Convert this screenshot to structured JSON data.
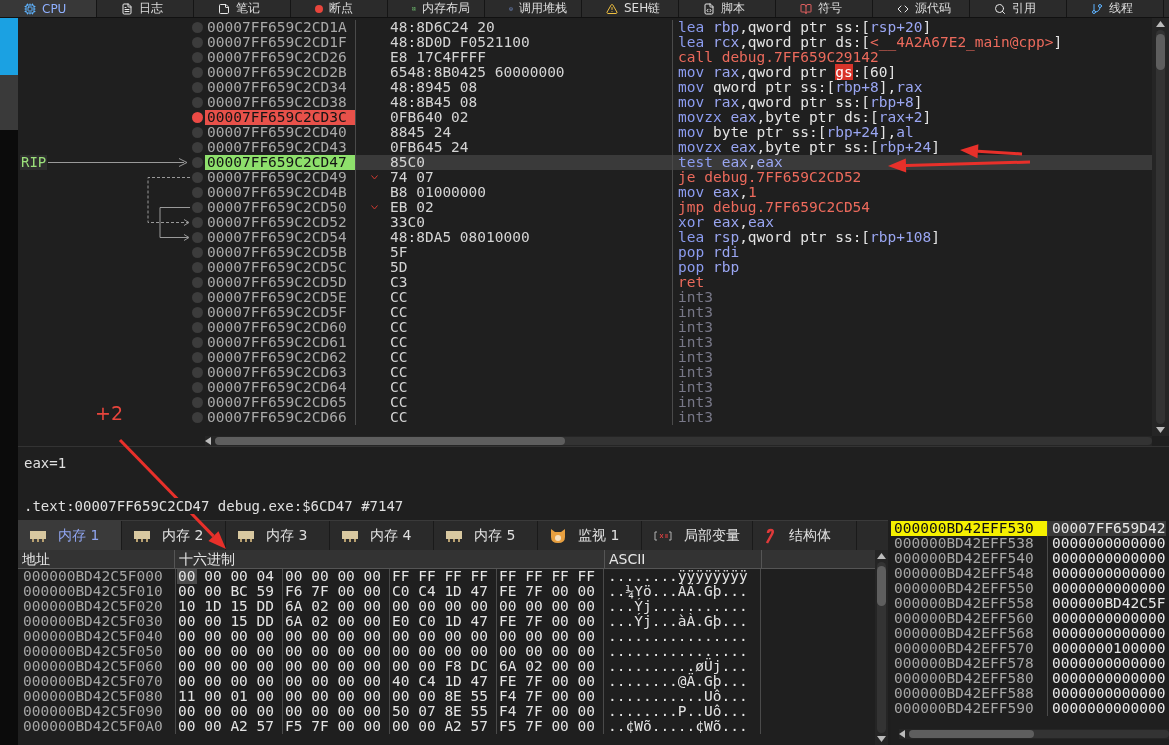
{
  "top_tabs": [
    {
      "label": "CPU",
      "kind": "cpu",
      "selected": true
    },
    {
      "label": "日志",
      "kind": "log",
      "selected": false
    },
    {
      "label": "笔记",
      "kind": "notes",
      "selected": false
    },
    {
      "label": "断点",
      "kind": "breakpoint",
      "selected": false
    },
    {
      "label": "内存布局",
      "kind": "memmap",
      "selected": false
    },
    {
      "label": "调用堆栈",
      "kind": "callstack",
      "selected": false
    },
    {
      "label": "SEH链",
      "kind": "seh",
      "selected": false
    },
    {
      "label": "脚本",
      "kind": "script",
      "selected": false
    },
    {
      "label": "符号",
      "kind": "symbol",
      "selected": false
    },
    {
      "label": "源代码",
      "kind": "source",
      "selected": false
    },
    {
      "label": "引用",
      "kind": "refs",
      "selected": false
    },
    {
      "label": "线程",
      "kind": "threads",
      "selected": false
    }
  ],
  "disasm": {
    "rip_label": "RIP",
    "rows": [
      {
        "address": "00007FF659C2CD1A",
        "bytes": "48:8D6C24 20",
        "mnemonic": "lea",
        "kind": "op",
        "operands": [
          {
            "text": "rbp",
            "kind": "reg"
          },
          {
            "text": ",qword ptr ss:[",
            "kind": "plain"
          },
          {
            "text": "rsp+20",
            "kind": "reg"
          },
          {
            "text": "]",
            "kind": "plain"
          }
        ],
        "breakpoint": false,
        "current": false,
        "jump": false
      },
      {
        "address": "00007FF659C2CD1F",
        "bytes": "48:8D0D F0521100",
        "mnemonic": "lea",
        "kind": "op",
        "operands": [
          {
            "text": "rcx",
            "kind": "reg"
          },
          {
            "text": ",qword ptr ds:[",
            "kind": "plain"
          },
          {
            "text": "<__4A2A67E2_main@cpp>",
            "kind": "addr"
          },
          {
            "text": "]",
            "kind": "plain"
          }
        ],
        "breakpoint": false,
        "current": false,
        "jump": false
      },
      {
        "address": "00007FF659C2CD26",
        "bytes": "E8 17C4FFFF",
        "mnemonic": "call",
        "kind": "branch",
        "operands": [
          {
            "text": "debug.7FF659C29142",
            "kind": "addr"
          }
        ],
        "breakpoint": false,
        "current": false,
        "jump": false
      },
      {
        "address": "00007FF659C2CD2B",
        "bytes": "6548:8B0425 60000000",
        "mnemonic": "mov",
        "kind": "op",
        "operands": [
          {
            "text": "rax",
            "kind": "reg"
          },
          {
            "text": ",qword ptr ",
            "kind": "plain"
          },
          {
            "text": "gs",
            "kind": "mark"
          },
          {
            "text": ":[60]",
            "kind": "plain"
          }
        ],
        "breakpoint": false,
        "current": false,
        "jump": false
      },
      {
        "address": "00007FF659C2CD34",
        "bytes": "48:8945 08",
        "mnemonic": "mov",
        "kind": "op",
        "operands": [
          {
            "text": "qword ptr ss:[",
            "kind": "plain"
          },
          {
            "text": "rbp+8",
            "kind": "reg"
          },
          {
            "text": "],",
            "kind": "plain"
          },
          {
            "text": "rax",
            "kind": "reg"
          }
        ],
        "breakpoint": false,
        "current": false,
        "jump": false
      },
      {
        "address": "00007FF659C2CD38",
        "bytes": "48:8B45 08",
        "mnemonic": "mov",
        "kind": "op",
        "operands": [
          {
            "text": "rax",
            "kind": "reg"
          },
          {
            "text": ",qword ptr ss:[",
            "kind": "plain"
          },
          {
            "text": "rbp+8",
            "kind": "reg"
          },
          {
            "text": "]",
            "kind": "plain"
          }
        ],
        "breakpoint": false,
        "current": false,
        "jump": false
      },
      {
        "address": "00007FF659C2CD3C",
        "bytes": "0FB640 02",
        "mnemonic": "movzx",
        "kind": "op",
        "operands": [
          {
            "text": "eax",
            "kind": "reg"
          },
          {
            "text": ",byte ptr ds:[",
            "kind": "plain"
          },
          {
            "text": "rax+2",
            "kind": "reg"
          },
          {
            "text": "]",
            "kind": "plain"
          }
        ],
        "breakpoint": true,
        "current": false,
        "jump": false
      },
      {
        "address": "00007FF659C2CD40",
        "bytes": "8845 24",
        "mnemonic": "mov",
        "kind": "op",
        "operands": [
          {
            "text": "byte ptr ss:[",
            "kind": "plain"
          },
          {
            "text": "rbp+24",
            "kind": "reg"
          },
          {
            "text": "],",
            "kind": "plain"
          },
          {
            "text": "al",
            "kind": "reg"
          }
        ],
        "breakpoint": false,
        "current": false,
        "jump": false
      },
      {
        "address": "00007FF659C2CD43",
        "bytes": "0FB645 24",
        "mnemonic": "movzx",
        "kind": "op",
        "operands": [
          {
            "text": "eax",
            "kind": "reg"
          },
          {
            "text": ",byte ptr ss:[",
            "kind": "plain"
          },
          {
            "text": "rbp+24",
            "kind": "reg"
          },
          {
            "text": "]",
            "kind": "plain"
          }
        ],
        "breakpoint": false,
        "current": false,
        "jump": false
      },
      {
        "address": "00007FF659C2CD47",
        "bytes": "85C0",
        "mnemonic": "test",
        "kind": "op",
        "operands": [
          {
            "text": "eax",
            "kind": "reg"
          },
          {
            "text": ",",
            "kind": "plain"
          },
          {
            "text": "eax",
            "kind": "reg"
          }
        ],
        "breakpoint": false,
        "current": true,
        "jump": false
      },
      {
        "address": "00007FF659C2CD49",
        "bytes": "74 07",
        "mnemonic": "je",
        "kind": "branch",
        "operands": [
          {
            "text": "debug.7FF659C2CD52",
            "kind": "addr"
          }
        ],
        "breakpoint": false,
        "current": false,
        "jump": true
      },
      {
        "address": "00007FF659C2CD4B",
        "bytes": "B8 01000000",
        "mnemonic": "mov",
        "kind": "op",
        "operands": [
          {
            "text": "eax",
            "kind": "reg"
          },
          {
            "text": ",",
            "kind": "plain"
          },
          {
            "text": "1",
            "kind": "addr"
          }
        ],
        "breakpoint": false,
        "current": false,
        "jump": false
      },
      {
        "address": "00007FF659C2CD50",
        "bytes": "EB 02",
        "mnemonic": "jmp",
        "kind": "branch",
        "operands": [
          {
            "text": "debug.7FF659C2CD54",
            "kind": "addr"
          }
        ],
        "breakpoint": false,
        "current": false,
        "jump": true
      },
      {
        "address": "00007FF659C2CD52",
        "bytes": "33C0",
        "mnemonic": "xor",
        "kind": "op",
        "operands": [
          {
            "text": "eax",
            "kind": "reg"
          },
          {
            "text": ",",
            "kind": "plain"
          },
          {
            "text": "eax",
            "kind": "reg"
          }
        ],
        "breakpoint": false,
        "current": false,
        "jump": false
      },
      {
        "address": "00007FF659C2CD54",
        "bytes": "48:8DA5 08010000",
        "mnemonic": "lea",
        "kind": "op",
        "operands": [
          {
            "text": "rsp",
            "kind": "reg"
          },
          {
            "text": ",qword ptr ss:[",
            "kind": "plain"
          },
          {
            "text": "rbp+108",
            "kind": "reg"
          },
          {
            "text": "]",
            "kind": "plain"
          }
        ],
        "breakpoint": false,
        "current": false,
        "jump": false
      },
      {
        "address": "00007FF659C2CD5B",
        "bytes": "5F",
        "mnemonic": "pop",
        "kind": "op",
        "operands": [
          {
            "text": "rdi",
            "kind": "reg"
          }
        ],
        "breakpoint": false,
        "current": false,
        "jump": false
      },
      {
        "address": "00007FF659C2CD5C",
        "bytes": "5D",
        "mnemonic": "pop",
        "kind": "op",
        "operands": [
          {
            "text": "rbp",
            "kind": "reg"
          }
        ],
        "breakpoint": false,
        "current": false,
        "jump": false
      },
      {
        "address": "00007FF659C2CD5D",
        "bytes": "C3",
        "mnemonic": "ret",
        "kind": "branch",
        "operands": [],
        "breakpoint": false,
        "current": false,
        "jump": false
      },
      {
        "address": "00007FF659C2CD5E",
        "bytes": "CC",
        "mnemonic": "int3",
        "kind": "pad",
        "operands": [],
        "breakpoint": false,
        "current": false,
        "jump": false
      },
      {
        "address": "00007FF659C2CD5F",
        "bytes": "CC",
        "mnemonic": "int3",
        "kind": "pad",
        "operands": [],
        "breakpoint": false,
        "current": false,
        "jump": false
      },
      {
        "address": "00007FF659C2CD60",
        "bytes": "CC",
        "mnemonic": "int3",
        "kind": "pad",
        "operands": [],
        "breakpoint": false,
        "current": false,
        "jump": false
      },
      {
        "address": "00007FF659C2CD61",
        "bytes": "CC",
        "mnemonic": "int3",
        "kind": "pad",
        "operands": [],
        "breakpoint": false,
        "current": false,
        "jump": false
      },
      {
        "address": "00007FF659C2CD62",
        "bytes": "CC",
        "mnemonic": "int3",
        "kind": "pad",
        "operands": [],
        "breakpoint": false,
        "current": false,
        "jump": false
      },
      {
        "address": "00007FF659C2CD63",
        "bytes": "CC",
        "mnemonic": "int3",
        "kind": "pad",
        "operands": [],
        "breakpoint": false,
        "current": false,
        "jump": false
      },
      {
        "address": "00007FF659C2CD64",
        "bytes": "CC",
        "mnemonic": "int3",
        "kind": "pad",
        "operands": [],
        "breakpoint": false,
        "current": false,
        "jump": false
      },
      {
        "address": "00007FF659C2CD65",
        "bytes": "CC",
        "mnemonic": "int3",
        "kind": "pad",
        "operands": [],
        "breakpoint": false,
        "current": false,
        "jump": false
      },
      {
        "address": "00007FF659C2CD66",
        "bytes": "CC",
        "mnemonic": "int3",
        "kind": "pad",
        "operands": [],
        "breakpoint": false,
        "current": false,
        "jump": false
      }
    ]
  },
  "info": {
    "expression": "eax=1",
    "location": ".text:00007FF659C2CD47 debug.exe:$6CD47 #7147"
  },
  "annotation": {
    "label": "+2"
  },
  "memory_tabs": [
    {
      "label": "内存 1",
      "kind": "memory",
      "selected": true
    },
    {
      "label": "内存 2",
      "kind": "memory",
      "selected": false
    },
    {
      "label": "内存 3",
      "kind": "memory",
      "selected": false
    },
    {
      "label": "内存 4",
      "kind": "memory",
      "selected": false
    },
    {
      "label": "内存 5",
      "kind": "memory",
      "selected": false
    },
    {
      "label": "监视 1",
      "kind": "watch",
      "selected": false
    },
    {
      "label": "局部变量",
      "kind": "locals",
      "selected": false
    },
    {
      "label": "结构体",
      "kind": "struct",
      "selected": false
    }
  ],
  "hex": {
    "columns": [
      "地址",
      "十六进制",
      "ASCII"
    ],
    "rows": [
      {
        "address": "000000BD42C5F000",
        "groups": [
          "00 00 00 04",
          "00 00 00 00",
          "FF FF FF FF",
          "FF FF FF FF"
        ],
        "ascii": "........ÿÿÿÿÿÿÿÿ",
        "cursor": true
      },
      {
        "address": "000000BD42C5F010",
        "groups": [
          "00 00 BC 59",
          "F6 7F 00 00",
          "C0 C4 1D 47",
          "FE 7F 00 00"
        ],
        "ascii": "..¼Yö...ÀÄ.Gþ...",
        "cursor": false
      },
      {
        "address": "000000BD42C5F020",
        "groups": [
          "10 1D 15 DD",
          "6A 02 00 00",
          "00 00 00 00",
          "00 00 00 00"
        ],
        "ascii": "...Ýj...........",
        "cursor": false
      },
      {
        "address": "000000BD42C5F030",
        "groups": [
          "00 00 15 DD",
          "6A 02 00 00",
          "E0 C0 1D 47",
          "FE 7F 00 00"
        ],
        "ascii": "...Ýj...àÀ.Gþ...",
        "cursor": false
      },
      {
        "address": "000000BD42C5F040",
        "groups": [
          "00 00 00 00",
          "00 00 00 00",
          "00 00 00 00",
          "00 00 00 00"
        ],
        "ascii": "................",
        "cursor": false
      },
      {
        "address": "000000BD42C5F050",
        "groups": [
          "00 00 00 00",
          "00 00 00 00",
          "00 00 00 00",
          "00 00 00 00"
        ],
        "ascii": "................",
        "cursor": false
      },
      {
        "address": "000000BD42C5F060",
        "groups": [
          "00 00 00 00",
          "00 00 00 00",
          "00 00 F8 DC",
          "6A 02 00 00"
        ],
        "ascii": "..........øÜj...",
        "cursor": false
      },
      {
        "address": "000000BD42C5F070",
        "groups": [
          "00 00 00 00",
          "00 00 00 00",
          "40 C4 1D 47",
          "FE 7F 00 00"
        ],
        "ascii": "........@Ä.Gþ...",
        "cursor": false
      },
      {
        "address": "000000BD42C5F080",
        "groups": [
          "11 00 01 00",
          "00 00 00 00",
          "00 00 8E 55",
          "F4 7F 00 00"
        ],
        "ascii": "...........Uô...",
        "cursor": false
      },
      {
        "address": "000000BD42C5F090",
        "groups": [
          "00 00 00 00",
          "00 00 00 00",
          "50 07 8E 55",
          "F4 7F 00 00"
        ],
        "ascii": "........P..Uô...",
        "cursor": false
      },
      {
        "address": "000000BD42C5F0A0",
        "groups": [
          "00 00 A2 57",
          "F5 7F 00 00",
          "00 00 A2 57",
          "F5 7F 00 00"
        ],
        "ascii": "..¢Wõ.....¢Wõ...",
        "cursor": false
      }
    ]
  },
  "stack": {
    "rows": [
      {
        "address": "000000BD42EFF530",
        "value": "00007FF659D42",
        "selected": true
      },
      {
        "address": "000000BD42EFF538",
        "value": "0000000000000",
        "selected": false
      },
      {
        "address": "000000BD42EFF540",
        "value": "0000000000000",
        "selected": false
      },
      {
        "address": "000000BD42EFF548",
        "value": "0000000000000",
        "selected": false
      },
      {
        "address": "000000BD42EFF550",
        "value": "0000000000000",
        "selected": false
      },
      {
        "address": "000000BD42EFF558",
        "value": "000000BD42C5F",
        "selected": false
      },
      {
        "address": "000000BD42EFF560",
        "value": "0000000000000",
        "selected": false
      },
      {
        "address": "000000BD42EFF568",
        "value": "0000000000000",
        "selected": false
      },
      {
        "address": "000000BD42EFF570",
        "value": "0000000100000",
        "selected": false
      },
      {
        "address": "000000BD42EFF578",
        "value": "0000000000000",
        "selected": false
      },
      {
        "address": "000000BD42EFF580",
        "value": "0000000000000",
        "selected": false
      },
      {
        "address": "000000BD42EFF588",
        "value": "0000000000000",
        "selected": false
      },
      {
        "address": "000000BD42EFF590",
        "value": "0000000000000",
        "selected": false
      }
    ]
  }
}
